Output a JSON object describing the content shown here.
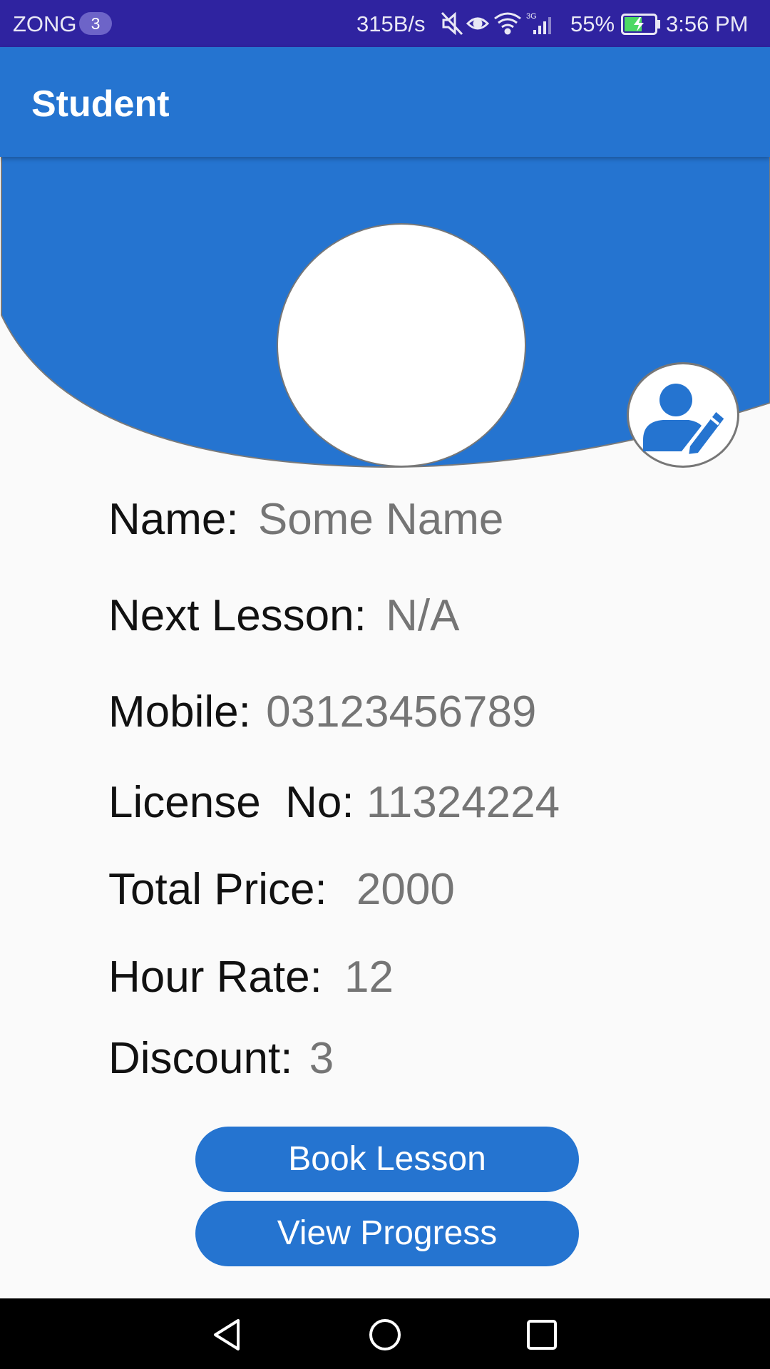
{
  "status_bar": {
    "carrier": "ZONG",
    "sim_badge": "3",
    "net_speed": "315B/s",
    "battery_pct": "55%",
    "time": "3:56 PM",
    "icons": [
      "mute-icon",
      "eye-icon",
      "wifi-icon",
      "signal-3g-icon",
      "battery-charging-icon"
    ]
  },
  "app_bar": {
    "title": "Student"
  },
  "profile": {
    "fields": [
      {
        "label": "Name:",
        "value": "Some Name"
      },
      {
        "label": "Next Lesson:",
        "value": "N/A"
      },
      {
        "label": "Mobile:",
        "value": "03123456789"
      },
      {
        "label": "License  No:",
        "value": "11324224"
      },
      {
        "label": "Total Price:",
        "value": "2000"
      },
      {
        "label": "Hour Rate:",
        "value": "12"
      },
      {
        "label": "Discount:",
        "value": "3"
      }
    ]
  },
  "actions": {
    "book_lesson": "Book Lesson",
    "view_progress": "View Progress"
  },
  "colors": {
    "status_bar": "#2f23a0",
    "primary": "#2574d0",
    "background": "#fafafa",
    "value_text": "#757575"
  }
}
